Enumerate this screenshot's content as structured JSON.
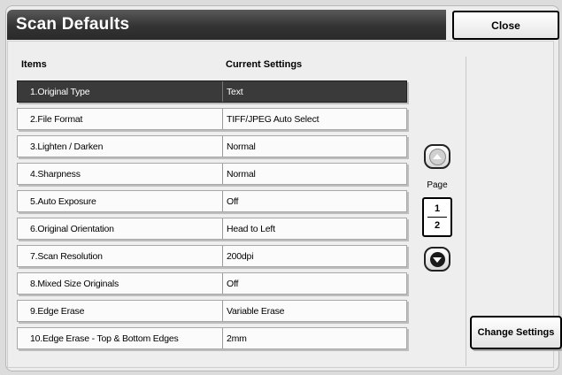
{
  "header": {
    "title": "Scan Defaults",
    "close_label": "Close"
  },
  "columns": {
    "items": "Items",
    "current_settings": "Current Settings"
  },
  "rows": [
    {
      "item": "1.Original Type",
      "value": "Text",
      "selected": true
    },
    {
      "item": "2.File Format",
      "value": "TIFF/JPEG Auto Select"
    },
    {
      "item": "3.Lighten / Darken",
      "value": "Normal"
    },
    {
      "item": "4.Sharpness",
      "value": "Normal"
    },
    {
      "item": "5.Auto Exposure",
      "value": "Off"
    },
    {
      "item": "6.Original Orientation",
      "value": "Head to Left"
    },
    {
      "item": "7.Scan Resolution",
      "value": "200dpi"
    },
    {
      "item": "8.Mixed Size Originals",
      "value": "Off"
    },
    {
      "item": "9.Edge Erase",
      "value": "Variable Erase"
    },
    {
      "item": "10.Edge Erase - Top & Bottom Edges",
      "value": "2mm"
    }
  ],
  "pager": {
    "label": "Page",
    "current": "1",
    "total": "2",
    "up_icon": "arrow-up-icon",
    "down_icon": "arrow-down-icon"
  },
  "actions": {
    "change_settings_label": "Change Settings"
  }
}
